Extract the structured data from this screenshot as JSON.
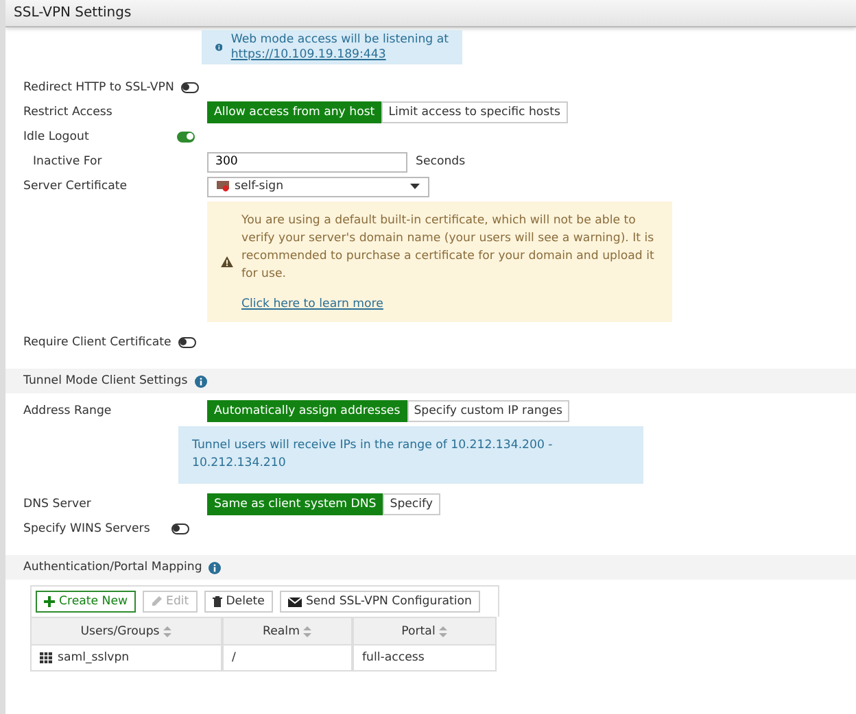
{
  "title": "SSL-VPN Settings",
  "web_notice": {
    "text": "Web mode access will be listening at",
    "link": "https://10.109.19.189:443"
  },
  "general": [
    {
      "kind": "toggle",
      "label": "Redirect HTTP to SSL-VPN",
      "on": false
    },
    {
      "kind": "choice",
      "label": "Restrict Access",
      "options": [
        {
          "label": "Allow access from any host",
          "selected": true
        },
        {
          "label": "Limit access to specific hosts",
          "selected": false
        }
      ]
    },
    {
      "kind": "toggle",
      "label": "Idle Logout",
      "on": true,
      "children": [
        {
          "kind": "number",
          "label": "Inactive For",
          "value": "300",
          "unit": "Seconds"
        }
      ]
    },
    {
      "kind": "select",
      "label": "Server Certificate",
      "value": "self-sign"
    },
    {
      "kind": "warning",
      "text": "You are using a default built-in certificate, which will not be able to verify your server's domain name (your users will see a warning). It is recommended to purchase a certificate for your domain and upload it for use.",
      "link": "Click here to learn more"
    },
    {
      "kind": "toggle",
      "label": "Require Client Certificate",
      "on": false
    }
  ],
  "tunnel": {
    "title": "Tunnel Mode Client Settings",
    "items": [
      {
        "kind": "choice",
        "label": "Address Range",
        "options": [
          {
            "label": "Automatically assign addresses",
            "selected": true
          },
          {
            "label": "Specify custom IP ranges",
            "selected": false
          }
        ]
      },
      {
        "kind": "info",
        "text": "Tunnel users will receive IPs in the range of 10.212.134.200 - 10.212.134.210"
      },
      {
        "kind": "choice",
        "label": "DNS Server",
        "options": [
          {
            "label": "Same as client system DNS",
            "selected": true
          },
          {
            "label": "Specify",
            "selected": false
          }
        ]
      },
      {
        "kind": "toggle",
        "label": "Specify WINS Servers",
        "on": false
      }
    ]
  },
  "mapping": {
    "title": "Authentication/Portal Mapping",
    "toolbar": [
      {
        "kind": "create",
        "label": "Create New",
        "disabled": false
      },
      {
        "kind": "edit",
        "label": "Edit",
        "disabled": true
      },
      {
        "kind": "delete",
        "label": "Delete",
        "disabled": false
      },
      {
        "kind": "send",
        "label": "Send SSL-VPN Configuration",
        "disabled": false
      }
    ],
    "columns": [
      "Users/Groups",
      "Realm",
      "Portal"
    ],
    "rows": [
      [
        "saml_sslvpn",
        "/",
        "full-access"
      ]
    ]
  }
}
